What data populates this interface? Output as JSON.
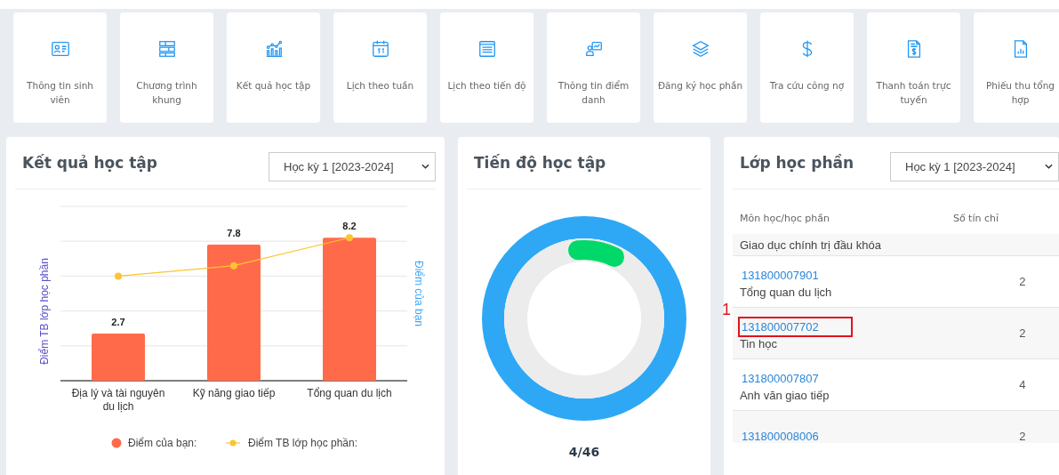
{
  "shortcuts": [
    {
      "label": "Thông tin sinh viên"
    },
    {
      "label": "Chương trình khung"
    },
    {
      "label": "Kết quả học tập"
    },
    {
      "label": "Lịch theo tuần"
    },
    {
      "label": "Lịch theo tiến độ"
    },
    {
      "label": "Thông tin điểm danh"
    },
    {
      "label": "Đăng ký học phần"
    },
    {
      "label": "Tra cứu công nợ"
    },
    {
      "label": "Thanh toán trực tuyến"
    },
    {
      "label": "Phiếu thu tổng hợp"
    }
  ],
  "results_panel": {
    "title": "Kết quả học tập",
    "semester": "Học kỳ 1 [2023-2024]",
    "chart_data": {
      "type": "bar",
      "ylabel": "Điểm TB lớp học phần",
      "y2label": "Điểm của bạn",
      "categories": [
        "Địa lý và tài nguyên du lịch",
        "Kỹ năng giao tiếp",
        "Tổng quan du lịch"
      ],
      "ylim": [
        0,
        10
      ],
      "legend": "bottom",
      "series": [
        {
          "name": "Điểm của bạn:",
          "color": "#ff6b4a",
          "values": [
            2.7,
            7.8,
            8.2
          ],
          "value_labels": [
            "2.7",
            "7.8",
            "8.2"
          ]
        },
        {
          "name": "Điểm TB lớp học phần:",
          "color": "#fbc531",
          "type": "line",
          "marker": "circle",
          "values": [
            6,
            6.6,
            8.2
          ],
          "value_labels": [
            null,
            null,
            null
          ]
        }
      ]
    }
  },
  "progress_panel": {
    "title": "Tiến độ học tập",
    "reading": "4/46"
  },
  "classes_panel": {
    "title": "Lớp học phần",
    "semester": "Học kỳ 1 [2023-2024]",
    "columns": [
      "Môn học/học phần",
      "Số tín chỉ"
    ],
    "rows": [
      {
        "name": "Giao dục chính trị đầu khóa"
      },
      {
        "code": "131800007901",
        "name": "Tổng quan du lịch",
        "credits": "2",
        "highlighted": false
      },
      {
        "code": "131800007702",
        "name": "Tin học",
        "credits": "2",
        "highlighted": true,
        "annotation": "1"
      },
      {
        "code": "131800007807",
        "name": "Anh văn giao tiếp",
        "credits": "4",
        "highlighted": false
      },
      {
        "code": "131800008006",
        "credits": "2",
        "highlighted": false
      }
    ]
  }
}
